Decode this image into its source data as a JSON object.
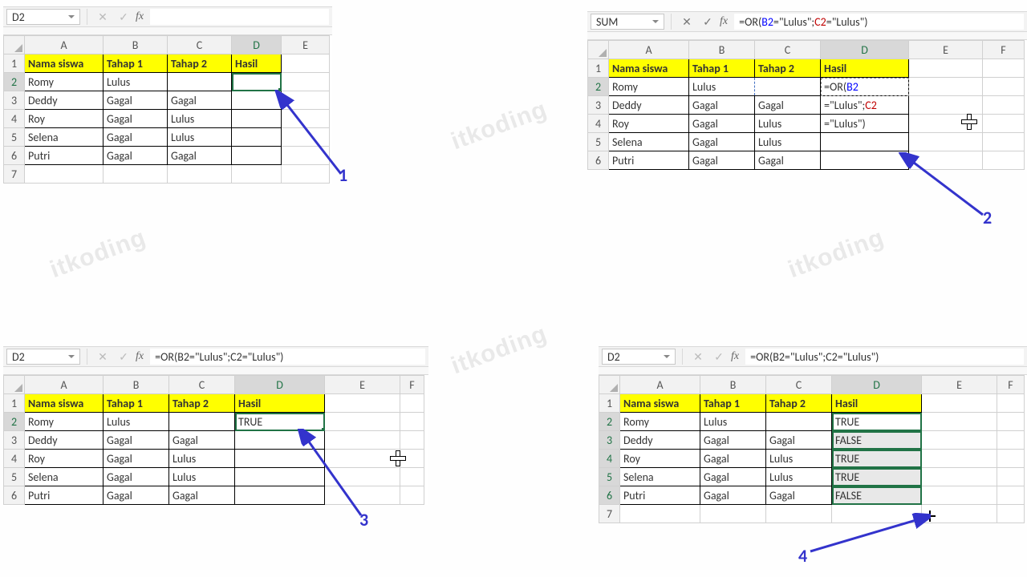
{
  "watermark": "itkoding",
  "formula_plain": "=OR(B2=\"Lulus\";C2=\"Lulus\")",
  "headers": {
    "a": "Nama siswa",
    "b": "Tahap 1",
    "c": "Tahap 2",
    "d": "Hasil"
  },
  "rows": [
    {
      "a": "Romy",
      "b": "Lulus",
      "c": "",
      "d3": "TRUE",
      "d4": "TRUE"
    },
    {
      "a": "Deddy",
      "b": "Gagal",
      "c": "Gagal",
      "d3": "",
      "d4": "FALSE"
    },
    {
      "a": "Roy",
      "b": "Gagal",
      "c": "Lulus",
      "d3": "",
      "d4": "TRUE"
    },
    {
      "a": "Selena",
      "b": "Gagal",
      "c": "Lulus",
      "d3": "",
      "d4": "TRUE"
    },
    {
      "a": "Putri",
      "b": "Gagal",
      "c": "Gagal",
      "d3": "",
      "d4": "FALSE"
    }
  ],
  "edit_overflow": {
    "d2": "=OR(B2",
    "d3": "=\"Lulus\";C2",
    "d4": "=\"Lulus\")"
  },
  "panel1": {
    "namebox": "D2",
    "formula": ""
  },
  "panel2": {
    "namebox": "SUM"
  },
  "panel3": {
    "namebox": "D2"
  },
  "panel4": {
    "namebox": "D2"
  },
  "cols": [
    "A",
    "B",
    "C",
    "D",
    "E"
  ],
  "extraCol": "F",
  "anno": {
    "n1": "1",
    "n2": "2",
    "n3": "3",
    "n4": "4"
  }
}
